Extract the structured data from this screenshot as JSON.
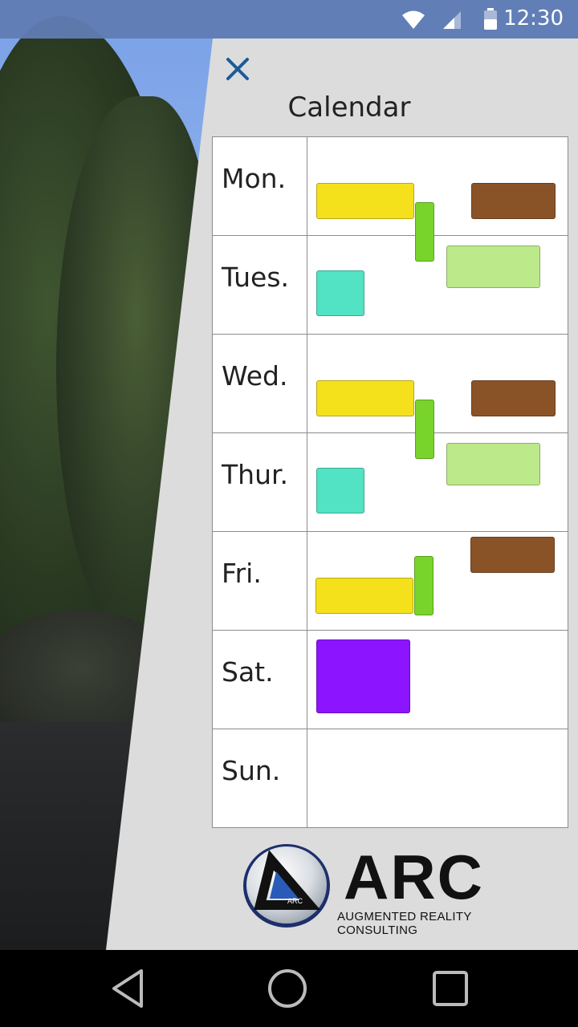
{
  "status_bar": {
    "time": "12:30",
    "icons": [
      "wifi-icon",
      "signal-icon",
      "battery-icon"
    ]
  },
  "calendar": {
    "title": "Calendar",
    "days": [
      "Mon.",
      "Tues.",
      "Wed.",
      "Thur.",
      "Fri.",
      "Sat.",
      "Sun."
    ]
  },
  "logo": {
    "name": "ARC",
    "tagline": "AUGMENTED REALITY CONSULTING",
    "mark_text": "ARC"
  },
  "colors": {
    "yellow": "#f5e01c",
    "brown": "#8a5327",
    "green": "#78d42a",
    "light_green": "#bce98a",
    "teal": "#52e2c4",
    "purple": "#8c14ff",
    "close": "#1b5a9a"
  },
  "nav": {
    "icons": [
      "back-icon",
      "home-icon",
      "recents-icon"
    ]
  }
}
